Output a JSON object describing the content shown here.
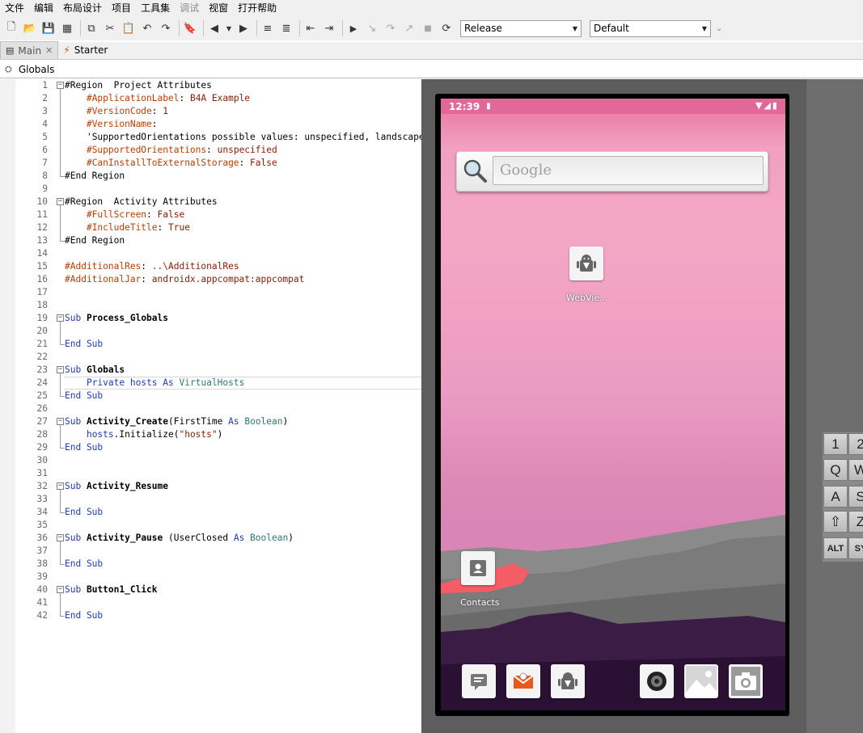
{
  "menu": [
    "文件",
    "编辑",
    "布局设计",
    "项目",
    "工具集",
    "调试",
    "视窗",
    "打开帮助"
  ],
  "menu_disabled": [
    "调试"
  ],
  "toolbar": {
    "build_config": "Release",
    "device": "Default"
  },
  "tabs": [
    {
      "label": "Main",
      "icon": "module-icon",
      "active": true
    },
    {
      "label": "Starter",
      "icon": "lightning-icon",
      "active": false
    }
  ],
  "module_label": "Globals",
  "code_lines": [
    {
      "n": "1",
      "fold": "open",
      "segs": [
        [
          "plain",
          "#Region  Project Attributes"
        ]
      ]
    },
    {
      "n": "2",
      "fold": "line",
      "segs": [
        [
          "plain",
          "    "
        ],
        [
          "dir",
          "#ApplicationLabel"
        ],
        [
          "plain",
          ": "
        ],
        [
          "str",
          "B4A Example"
        ]
      ]
    },
    {
      "n": "3",
      "fold": "line",
      "segs": [
        [
          "plain",
          "    "
        ],
        [
          "dir",
          "#VersionCode"
        ],
        [
          "plain",
          ": "
        ],
        [
          "str",
          "1"
        ]
      ]
    },
    {
      "n": "4",
      "fold": "line",
      "segs": [
        [
          "plain",
          "    "
        ],
        [
          "dir",
          "#VersionName"
        ],
        [
          "plain",
          ":"
        ]
      ]
    },
    {
      "n": "5",
      "fold": "line",
      "segs": [
        [
          "plain",
          "    "
        ],
        [
          "cmt",
          "'SupportedOrientations possible values: unspecified, landscape or portrait."
        ]
      ]
    },
    {
      "n": "6",
      "fold": "line",
      "segs": [
        [
          "plain",
          "    "
        ],
        [
          "dir",
          "#SupportedOrientations"
        ],
        [
          "plain",
          ": "
        ],
        [
          "str",
          "unspecified"
        ]
      ]
    },
    {
      "n": "7",
      "fold": "line",
      "segs": [
        [
          "plain",
          "    "
        ],
        [
          "dir",
          "#CanInstallToExternalStorage"
        ],
        [
          "plain",
          ": "
        ],
        [
          "str",
          "False"
        ]
      ]
    },
    {
      "n": "8",
      "fold": "end",
      "segs": [
        [
          "plain",
          "#End Region"
        ]
      ]
    },
    {
      "n": "9",
      "fold": "",
      "segs": []
    },
    {
      "n": "10",
      "fold": "open",
      "segs": [
        [
          "plain",
          "#Region  Activity Attributes"
        ]
      ]
    },
    {
      "n": "11",
      "fold": "line",
      "segs": [
        [
          "plain",
          "    "
        ],
        [
          "dir",
          "#FullScreen"
        ],
        [
          "plain",
          ": "
        ],
        [
          "str",
          "False"
        ]
      ]
    },
    {
      "n": "12",
      "fold": "line",
      "segs": [
        [
          "plain",
          "    "
        ],
        [
          "dir",
          "#IncludeTitle"
        ],
        [
          "plain",
          ": "
        ],
        [
          "str",
          "True"
        ]
      ]
    },
    {
      "n": "13",
      "fold": "end",
      "segs": [
        [
          "plain",
          "#End Region"
        ]
      ]
    },
    {
      "n": "14",
      "fold": "",
      "segs": []
    },
    {
      "n": "15",
      "fold": "",
      "segs": [
        [
          "dir",
          "#AdditionalRes"
        ],
        [
          "plain",
          ": "
        ],
        [
          "str",
          "..\\AdditionalRes"
        ]
      ]
    },
    {
      "n": "16",
      "fold": "",
      "segs": [
        [
          "dir",
          "#AdditionalJar"
        ],
        [
          "plain",
          ": "
        ],
        [
          "str",
          "androidx.appcompat:appcompat"
        ]
      ]
    },
    {
      "n": "17",
      "fold": "",
      "segs": []
    },
    {
      "n": "18",
      "fold": "",
      "segs": []
    },
    {
      "n": "19",
      "fold": "open",
      "segs": [
        [
          "kw",
          "Sub"
        ],
        [
          "plain",
          " "
        ],
        [
          "bold",
          "Process_Globals"
        ]
      ]
    },
    {
      "n": "20",
      "fold": "line",
      "segs": []
    },
    {
      "n": "21",
      "fold": "end",
      "segs": [
        [
          "kw",
          "End Sub"
        ]
      ]
    },
    {
      "n": "22",
      "fold": "",
      "segs": []
    },
    {
      "n": "23",
      "fold": "open",
      "segs": [
        [
          "kw",
          "Sub"
        ],
        [
          "plain",
          " "
        ],
        [
          "bold",
          "Globals"
        ]
      ]
    },
    {
      "n": "24",
      "fold": "line",
      "current": true,
      "segs": [
        [
          "plain",
          "    "
        ],
        [
          "kw",
          "Private"
        ],
        [
          "plain",
          " "
        ],
        [
          "var",
          "hosts"
        ],
        [
          "plain",
          " "
        ],
        [
          "kw",
          "As"
        ],
        [
          "plain",
          " "
        ],
        [
          "typ",
          "VirtualHosts"
        ]
      ]
    },
    {
      "n": "25",
      "fold": "end",
      "segs": [
        [
          "kw",
          "End Sub"
        ]
      ]
    },
    {
      "n": "26",
      "fold": "",
      "segs": []
    },
    {
      "n": "27",
      "fold": "open",
      "segs": [
        [
          "kw",
          "Sub"
        ],
        [
          "plain",
          " "
        ],
        [
          "bold",
          "Activity_Create"
        ],
        [
          "plain",
          "(FirstTime "
        ],
        [
          "kw",
          "As"
        ],
        [
          "plain",
          " "
        ],
        [
          "typ",
          "Boolean"
        ],
        [
          "plain",
          ")"
        ]
      ]
    },
    {
      "n": "28",
      "fold": "line",
      "segs": [
        [
          "plain",
          "    "
        ],
        [
          "var",
          "hosts"
        ],
        [
          "plain",
          ".Initialize("
        ],
        [
          "str",
          "\"hosts\""
        ],
        [
          "plain",
          ")"
        ]
      ]
    },
    {
      "n": "29",
      "fold": "end",
      "segs": [
        [
          "kw",
          "End Sub"
        ]
      ]
    },
    {
      "n": "30",
      "fold": "",
      "segs": []
    },
    {
      "n": "31",
      "fold": "",
      "segs": []
    },
    {
      "n": "32",
      "fold": "open",
      "segs": [
        [
          "kw",
          "Sub"
        ],
        [
          "plain",
          " "
        ],
        [
          "bold",
          "Activity_Resume"
        ]
      ]
    },
    {
      "n": "33",
      "fold": "line",
      "segs": []
    },
    {
      "n": "34",
      "fold": "end",
      "segs": [
        [
          "kw",
          "End Sub"
        ]
      ]
    },
    {
      "n": "35",
      "fold": "",
      "segs": []
    },
    {
      "n": "36",
      "fold": "open",
      "segs": [
        [
          "kw",
          "Sub"
        ],
        [
          "plain",
          " "
        ],
        [
          "bold",
          "Activity_Pause"
        ],
        [
          "plain",
          " (UserClosed "
        ],
        [
          "kw",
          "As"
        ],
        [
          "plain",
          " "
        ],
        [
          "typ",
          "Boolean"
        ],
        [
          "plain",
          ")"
        ]
      ]
    },
    {
      "n": "37",
      "fold": "line",
      "segs": []
    },
    {
      "n": "38",
      "fold": "end",
      "segs": [
        [
          "kw",
          "End Sub"
        ]
      ]
    },
    {
      "n": "39",
      "fold": "",
      "segs": []
    },
    {
      "n": "40",
      "fold": "open",
      "segs": [
        [
          "kw",
          "Sub"
        ],
        [
          "plain",
          " "
        ],
        [
          "bold",
          "Button1_Click"
        ]
      ]
    },
    {
      "n": "41",
      "fold": "line",
      "segs": []
    },
    {
      "n": "42",
      "fold": "end",
      "segs": [
        [
          "kw",
          "End Sub"
        ]
      ]
    }
  ],
  "emulator": {
    "time": "12:39",
    "search_placeholder": "Google",
    "desktop_apps": [
      {
        "label": "WebVie...",
        "icon": "android-app-icon"
      },
      {
        "label": "Contacts",
        "icon": "contacts-icon"
      }
    ],
    "dock_icons": [
      "messaging-icon",
      "email-icon",
      "android-app-icon",
      "music-icon",
      "gallery-icon",
      "camera-icon"
    ],
    "keypad": [
      "1",
      "2",
      "Q",
      "W",
      "A",
      "S",
      "Z",
      "ALT",
      "SY"
    ]
  },
  "colors": {
    "keyword": "#1f3bb6",
    "directive": "#c13b00",
    "string": "#8b1a00",
    "type": "#2b7a78"
  }
}
